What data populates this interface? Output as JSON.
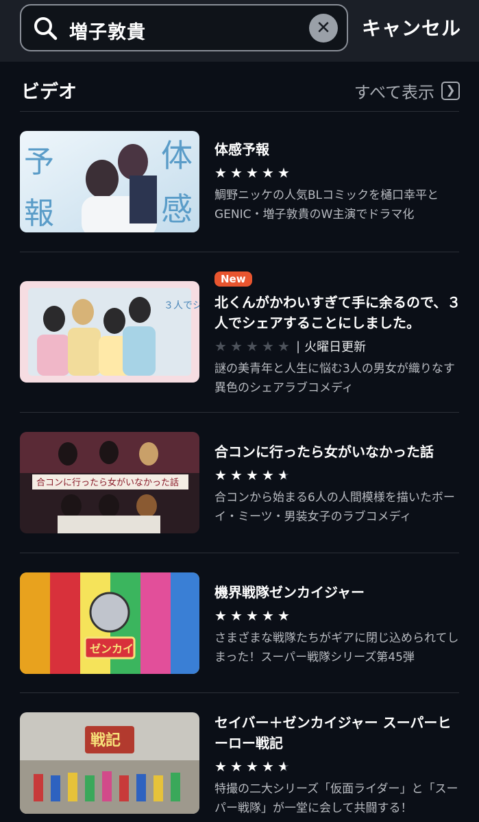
{
  "search": {
    "query": "増子敦貴",
    "cancel_label": "キャンセル"
  },
  "section": {
    "title": "ビデオ",
    "show_all_label": "すべて表示"
  },
  "videos": [
    {
      "title": "体感予報",
      "badge": "",
      "rating": 5,
      "schedule": "",
      "description": "鯛野ニッケの人気BLコミックを樋口幸平とGENIC・増子敦貴のW主演でドラマ化",
      "thumb_colors": [
        "#d9ecf6",
        "#a8c8e0",
        "#5e8fb8"
      ]
    },
    {
      "title": "北くんがかわいすぎて手に余るので、３人でシェアすることにしました。",
      "badge": "New",
      "rating": 0,
      "schedule": "火曜日更新",
      "description": "謎の美青年と人生に悩む3人の男女が織りなす異色のシェアラブコメディ",
      "thumb_colors": [
        "#f3d9df",
        "#e7c9a0",
        "#8fb7d8"
      ]
    },
    {
      "title": "合コンに行ったら女がいなかった話",
      "badge": "",
      "rating": 4.5,
      "schedule": "",
      "description": "合コンから始まる6人の人間模様を描いたボーイ・ミーツ・男装女子のラブコメディ",
      "thumb_colors": [
        "#2a1c22",
        "#7a3a4a",
        "#e0d6cc"
      ]
    },
    {
      "title": "機界戦隊ゼンカイジャー",
      "badge": "",
      "rating": 5,
      "schedule": "",
      "description": "さまざまな戦隊たちがギアに閉じ込められてしまった！スーパー戦隊シリーズ第45弾",
      "thumb_colors": [
        "#f2c12e",
        "#d8313b",
        "#3a7fd5"
      ]
    },
    {
      "title": "セイバー＋ゼンカイジャー スーパーヒーロー戦記",
      "badge": "",
      "rating": 4.5,
      "schedule": "",
      "description": "特撮の二大シリーズ「仮面ライダー」と「スーパー戦隊」が一堂に会して共闘する！",
      "thumb_colors": [
        "#c9c7c0",
        "#8a857a",
        "#b23a2e"
      ]
    }
  ]
}
